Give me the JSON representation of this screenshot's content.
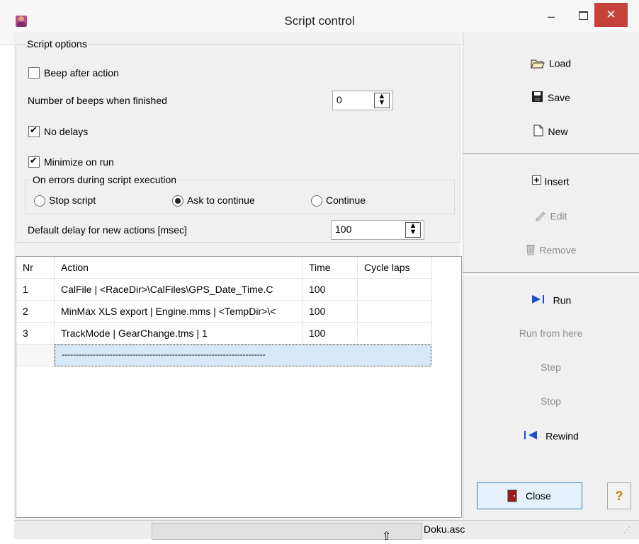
{
  "window": {
    "title": "Script control",
    "minimize": "–",
    "close": "✕"
  },
  "options": {
    "group_label": "Script options",
    "beep_after_action": {
      "label": "Beep after action",
      "checked": false
    },
    "beeps_when_finished": {
      "label": "Number of beeps when finished",
      "value": "0"
    },
    "no_delays": {
      "label": "No delays",
      "checked": true
    },
    "minimize_on_run": {
      "label": "Minimize on run",
      "checked": true
    },
    "on_errors": {
      "label": "On errors during script execution",
      "options": [
        "Stop script",
        "Ask to continue",
        "Continue"
      ],
      "selected": "Ask to continue"
    },
    "default_delay": {
      "label": "Default delay for new actions [msec]",
      "value": "100"
    }
  },
  "table": {
    "columns": [
      "Nr",
      "Action",
      "Time",
      "Cycle laps"
    ],
    "rows": [
      {
        "nr": "1",
        "action": "CalFile | <RaceDir>\\CalFiles\\GPS_Date_Time.C",
        "time": "100",
        "cycle": ""
      },
      {
        "nr": "2",
        "action": "MinMax XLS export | Engine.mms | <TempDir>\\<",
        "time": "100",
        "cycle": ""
      },
      {
        "nr": "3",
        "action": "TrackMode | GearChange.tms | 1",
        "time": "100",
        "cycle": ""
      }
    ],
    "new_row_placeholder": "------------------------------------------------------------------------"
  },
  "buttons": {
    "load": "Load",
    "save": "Save",
    "new": "New",
    "insert": "Insert",
    "edit": "Edit",
    "remove": "Remove",
    "run": "Run",
    "run_from_here": "Run from here",
    "step": "Step",
    "stop": "Stop",
    "rewind": "Rewind",
    "close": "Close",
    "help": "?"
  },
  "status": {
    "file": "Doku.asc"
  },
  "colors": {
    "accent_blue": "#1f4fc8",
    "close_red": "#c7413b",
    "selection": "#d7e8f8"
  }
}
